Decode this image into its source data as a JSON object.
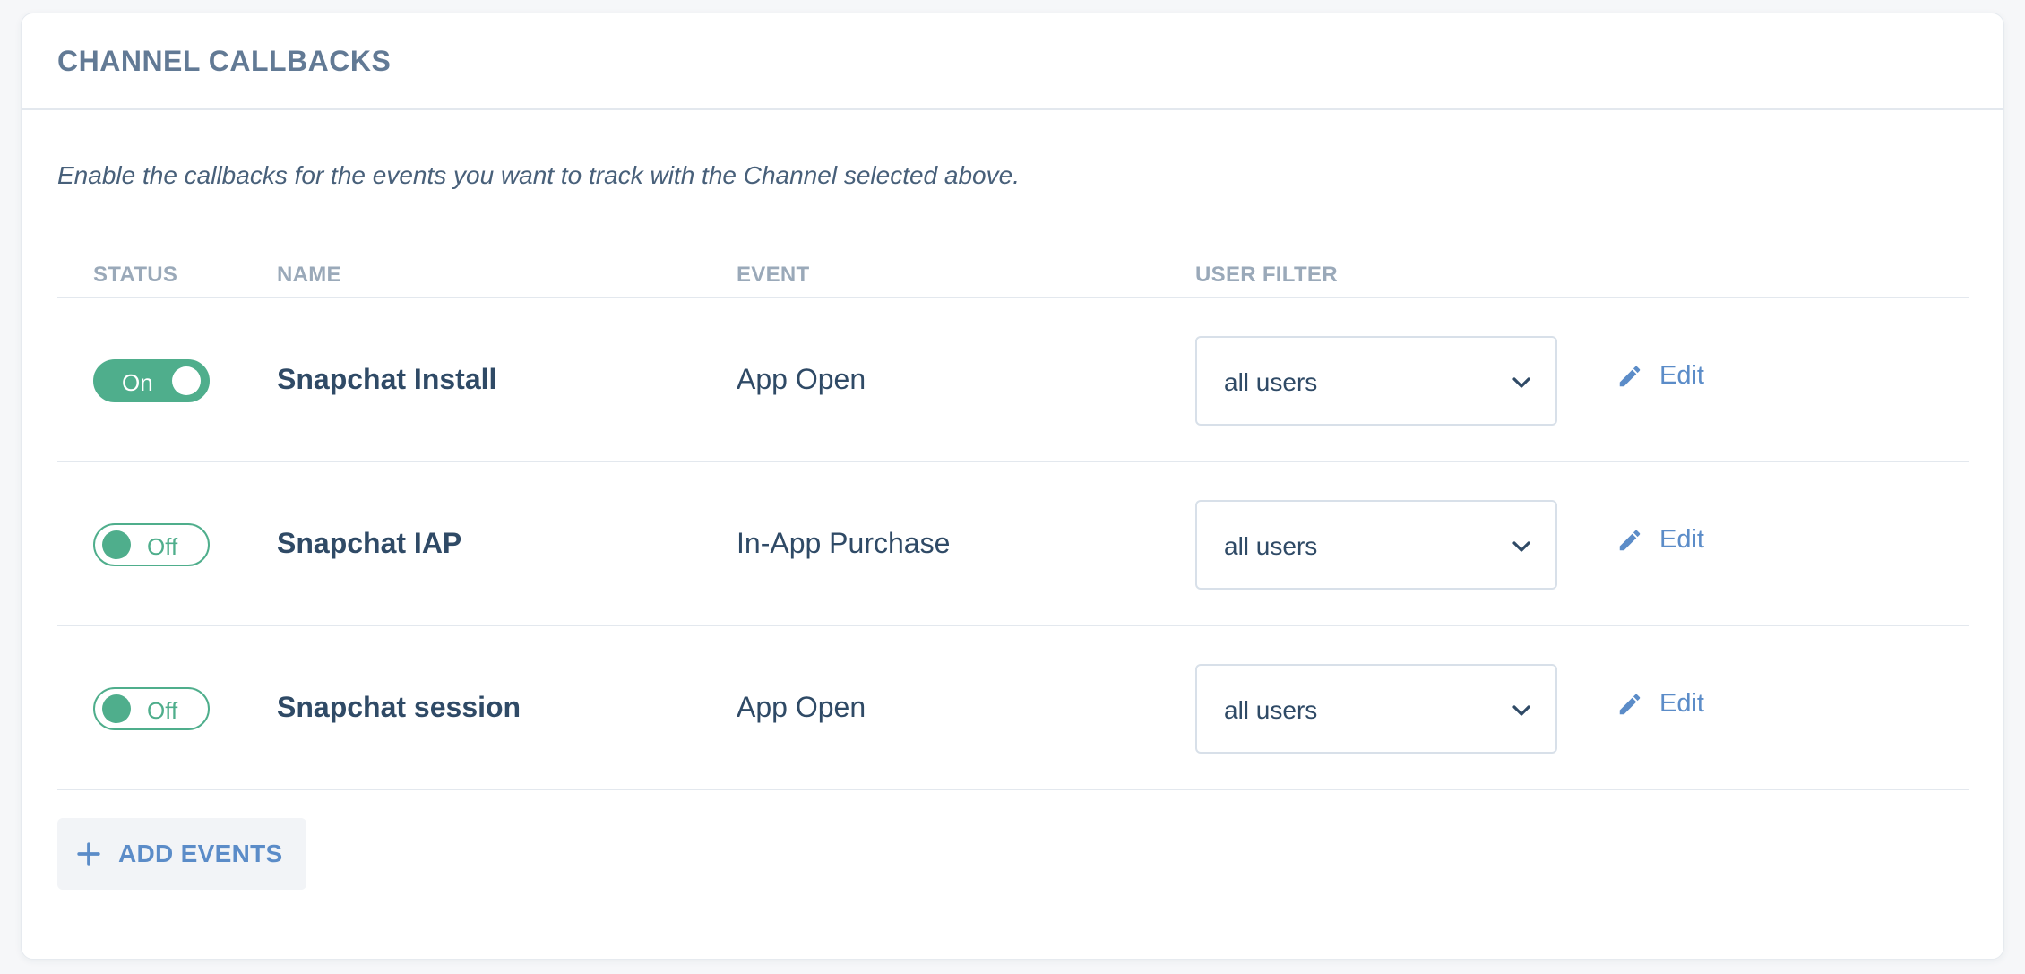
{
  "header": {
    "title": "CHANNEL CALLBACKS"
  },
  "description": "Enable the callbacks for the events you want to track with the Channel selected above.",
  "columns": {
    "status": "STATUS",
    "name": "NAME",
    "event": "EVENT",
    "user_filter": "USER FILTER"
  },
  "rows": [
    {
      "status": "On",
      "name": "Snapchat Install",
      "event": "App Open",
      "user_filter": "all users",
      "edit_label": "Edit"
    },
    {
      "status": "Off",
      "name": "Snapchat IAP",
      "event": "In-App Purchase",
      "user_filter": "all users",
      "edit_label": "Edit"
    },
    {
      "status": "Off",
      "name": "Snapchat session",
      "event": "App Open",
      "user_filter": "all users",
      "edit_label": "Edit"
    }
  ],
  "add_button": {
    "label": "ADD EVENTS",
    "icon": "plus-icon"
  },
  "colors": {
    "accent_green": "#4fae8c",
    "link_blue": "#5b8cc8",
    "title_gray": "#627a95",
    "text_dark": "#2f4a66"
  }
}
